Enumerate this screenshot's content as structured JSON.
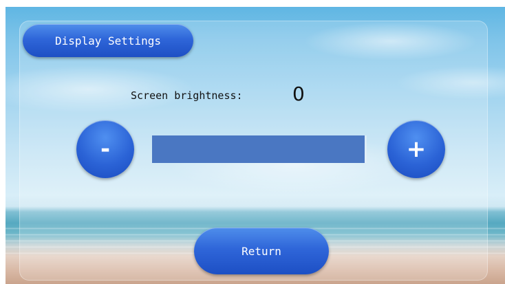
{
  "header": {
    "title": "Display Settings"
  },
  "brightness": {
    "label": "Screen brightness:",
    "value": "0",
    "bar_fill_fraction": 0.99
  },
  "controls": {
    "decrease_label": "-",
    "increase_label": "+",
    "return_label": "Return"
  },
  "colors": {
    "button_blue": "#2f66d9",
    "bar_fill": "#4a77c2",
    "text": "#111111"
  }
}
